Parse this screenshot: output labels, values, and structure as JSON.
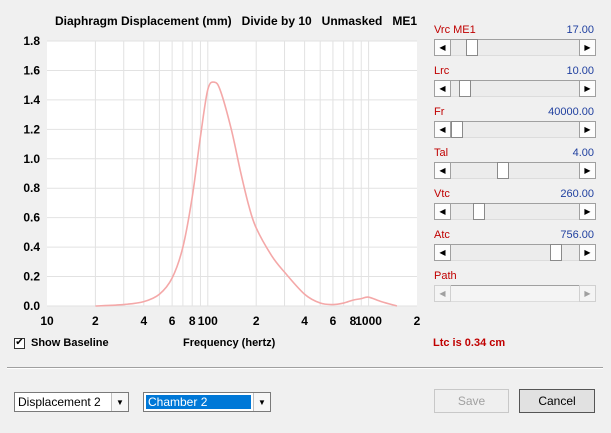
{
  "chart_data": {
    "type": "line",
    "title": "Diaphragm Displacement (mm)   Divide by 10   Unmasked   ME1",
    "xlabel": "Frequency (hertz)",
    "x_scale": "log",
    "xlim": [
      10,
      2000
    ],
    "ylim": [
      0,
      1.8
    ],
    "y_ticks": [
      "0.0",
      "0.2",
      "0.4",
      "0.6",
      "0.8",
      "1.0",
      "1.2",
      "1.4",
      "1.6",
      "1.8"
    ],
    "x_ticks": [
      "10",
      "2",
      "4",
      "6",
      "8",
      "100",
      "2",
      "4",
      "6",
      "8",
      "1000",
      "2"
    ],
    "x_tick_values": [
      10,
      20,
      40,
      60,
      80,
      100,
      200,
      400,
      600,
      800,
      1000,
      2000
    ],
    "grid": true,
    "series_color": "#f4a8a8",
    "series": [
      {
        "x": [
          20,
          30,
          40,
          50,
          60,
          70,
          80,
          90,
          100,
          110,
          120,
          140,
          160,
          180,
          200,
          250,
          300,
          400,
          500,
          600,
          700,
          800,
          900,
          1000,
          1200,
          1500
        ],
        "y": [
          0.0,
          0.01,
          0.03,
          0.08,
          0.19,
          0.4,
          0.74,
          1.15,
          1.47,
          1.52,
          1.46,
          1.2,
          0.91,
          0.68,
          0.53,
          0.34,
          0.23,
          0.08,
          0.02,
          0.01,
          0.02,
          0.04,
          0.05,
          0.06,
          0.03,
          0.0
        ]
      }
    ]
  },
  "sliders": [
    {
      "label": "Vrc  ME1",
      "value": "17.00",
      "level": 0.13,
      "enabled": true
    },
    {
      "label": "Lrc",
      "value": "10.00",
      "level": 0.07,
      "enabled": true
    },
    {
      "label": "Fr",
      "value": "40000.00",
      "level": 0.0,
      "enabled": true
    },
    {
      "label": "Tal",
      "value": "4.00",
      "level": 0.4,
      "enabled": true
    },
    {
      "label": "Vtc",
      "value": "260.00",
      "level": 0.19,
      "enabled": true
    },
    {
      "label": "Atc",
      "value": "756.00",
      "level": 0.85,
      "enabled": true
    },
    {
      "label": "Path",
      "value": "",
      "level": 0.0,
      "enabled": false
    }
  ],
  "status": {
    "ltc_text": "Ltc is 0.34 cm"
  },
  "baseline": {
    "checked_mark": "✔",
    "label": "Show Baseline"
  },
  "selects": {
    "displacement": "Displacement 2",
    "chamber": "Chamber 2"
  },
  "buttons": {
    "save": "Save",
    "cancel": "Cancel"
  },
  "icons": {
    "left": "arrow-left-icon",
    "right": "arrow-right-icon",
    "dropdown": "chevron-down-icon",
    "check": "check-icon"
  }
}
